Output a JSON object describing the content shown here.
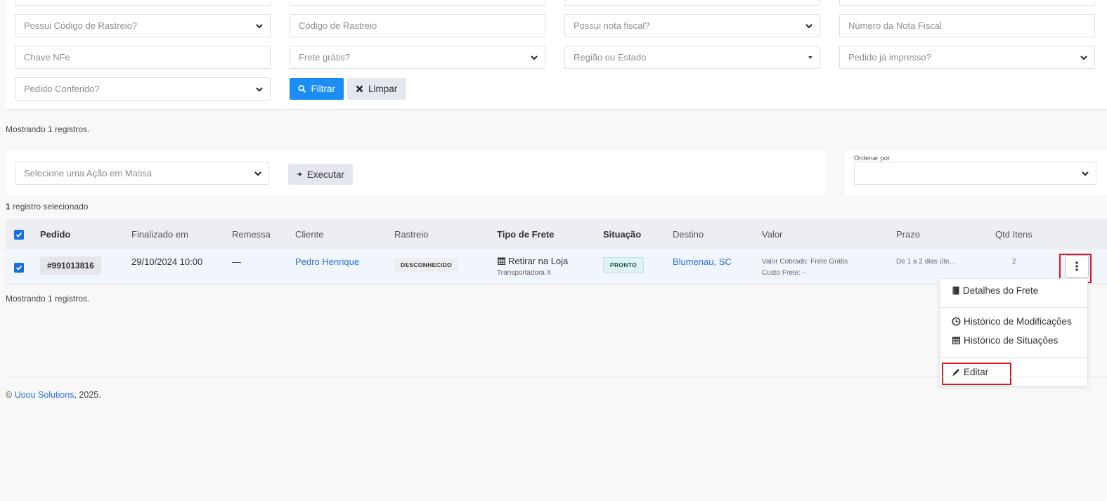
{
  "filters": {
    "rastreio_select": "Possui Código de Rastreio?",
    "codigo_rastreio": "Código de Rastreio",
    "nota_fiscal_select": "Possui nota fiscal?",
    "numero_nota": "Número da Nota Fiscal",
    "chave_nfe": "Chave NFe",
    "frete_gratis": "Frete grátis?",
    "regiao": "Região ou Estado",
    "impresso": "Pedido já impresso?",
    "conferido": "Pedido Conferido?",
    "filtrar_label": "Filtrar",
    "limpar_label": "Limpar"
  },
  "showing_top": "Mostrando 1 registros.",
  "bulk": {
    "select_placeholder": "Selecione uma Ação em Massa",
    "execute_label": "Executar"
  },
  "order": {
    "label": "Ordenar por",
    "value": ""
  },
  "selection": {
    "count": "1",
    "text": " registro selecionado"
  },
  "table": {
    "headers": [
      "Pedido",
      "Finalizado em",
      "Remessa",
      "Cliente",
      "Rastreio",
      "Tipo de Frete",
      "Situação",
      "Destino",
      "Valor",
      "Prazo",
      "Qtd Itens"
    ],
    "row": {
      "pedido": "#991013816",
      "finalizado": "29/10/2024 10:00",
      "remessa": "—",
      "cliente": "Pedro Henrique",
      "rastreio": "DESCONHECIDO",
      "tipo_frete": "Retirar na Loja",
      "transportadora": "Transportadora X",
      "situacao": "PRONTO",
      "destino": "Blumenau, SC",
      "valor_cobrado": "Valor Cobrado: Frete Grátis",
      "custo_frete": "Custo Frete: -",
      "prazo": "De 1 a 2 dias úte...",
      "qtd": "2"
    }
  },
  "menu": {
    "detalhes": "Detalhes do Frete",
    "historico_mod": "Histórico de Modificações",
    "historico_sit": "Histórico de Situações",
    "editar": "Editar"
  },
  "showing_bottom": "Mostrando 1 registros.",
  "footer": {
    "copy": "© ",
    "company": "Uoou Solutions",
    "year": ", 2025."
  },
  "colors": {
    "primary": "#1a8ef5",
    "link": "#2a73d6",
    "highlight": "#e0141e",
    "pronto_bg": "#dff3f6"
  }
}
